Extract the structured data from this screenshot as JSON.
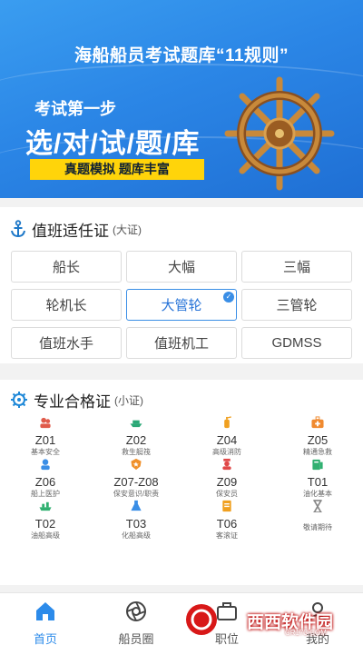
{
  "banner": {
    "title": "海船船员考试题库“11规则”",
    "line1": "考试第一步",
    "line2": "选/对/试/题/库",
    "tag": "真题模拟  题库丰富"
  },
  "watch_cert": {
    "title": "值班适任证",
    "subtitle": "(大证)",
    "items": [
      {
        "label": "船长"
      },
      {
        "label": "大幅"
      },
      {
        "label": "三幅"
      },
      {
        "label": "轮机长"
      },
      {
        "label": "大管轮",
        "selected": true
      },
      {
        "label": "三管轮"
      },
      {
        "label": "值班水手"
      },
      {
        "label": "值班机工"
      },
      {
        "label": "GDMSS"
      }
    ]
  },
  "pro_cert": {
    "title": "专业合格证",
    "subtitle": "(小证)",
    "items": [
      {
        "code": "Z01",
        "desc": "基本安全",
        "icon": "people-icon",
        "color": "#e05a4a"
      },
      {
        "code": "Z02",
        "desc": "救生艇筏",
        "icon": "lifeboat-icon",
        "color": "#2aa876"
      },
      {
        "code": "Z04",
        "desc": "高级消防",
        "icon": "fire-extinguisher-icon",
        "color": "#f0a020"
      },
      {
        "code": "Z05",
        "desc": "精通急救",
        "icon": "first-aid-kit-icon",
        "color": "#f08a30"
      },
      {
        "code": "Z06",
        "desc": "船上医护",
        "icon": "medical-staff-icon",
        "color": "#3a8ee6"
      },
      {
        "code": "Z07-Z08",
        "desc": "保安意识/职责",
        "icon": "security-badge-icon",
        "color": "#f0902a"
      },
      {
        "code": "Z09",
        "desc": "保安员",
        "icon": "security-guard-icon",
        "color": "#e04848"
      },
      {
        "code": "T01",
        "desc": "油化基本",
        "icon": "tanker-icon",
        "color": "#30b070"
      },
      {
        "code": "T02",
        "desc": "油船高级",
        "icon": "oil-tanker-icon",
        "color": "#30b070"
      },
      {
        "code": "T03",
        "desc": "化船高级",
        "icon": "flask-icon",
        "color": "#3a8ee6"
      },
      {
        "code": "T06",
        "desc": "客滚证",
        "icon": "certificate-icon",
        "color": "#f0a020"
      },
      {
        "code": "",
        "desc": "敬请期待",
        "icon": "hourglass-icon",
        "color": "#888888"
      }
    ]
  },
  "nav": {
    "items": [
      {
        "label": "首页",
        "icon": "home-icon",
        "active": true
      },
      {
        "label": "船员圈",
        "icon": "aperture-icon",
        "active": false
      },
      {
        "label": "职位",
        "icon": "briefcase-icon",
        "active": false
      },
      {
        "label": "我的",
        "icon": "person-icon",
        "active": false
      }
    ]
  },
  "watermark": {
    "text": "西西软件园",
    "url": "CR173.COM"
  },
  "colors": {
    "accent": "#2c8bea",
    "banner": "#2b86e6",
    "tag": "#ffd40a"
  }
}
